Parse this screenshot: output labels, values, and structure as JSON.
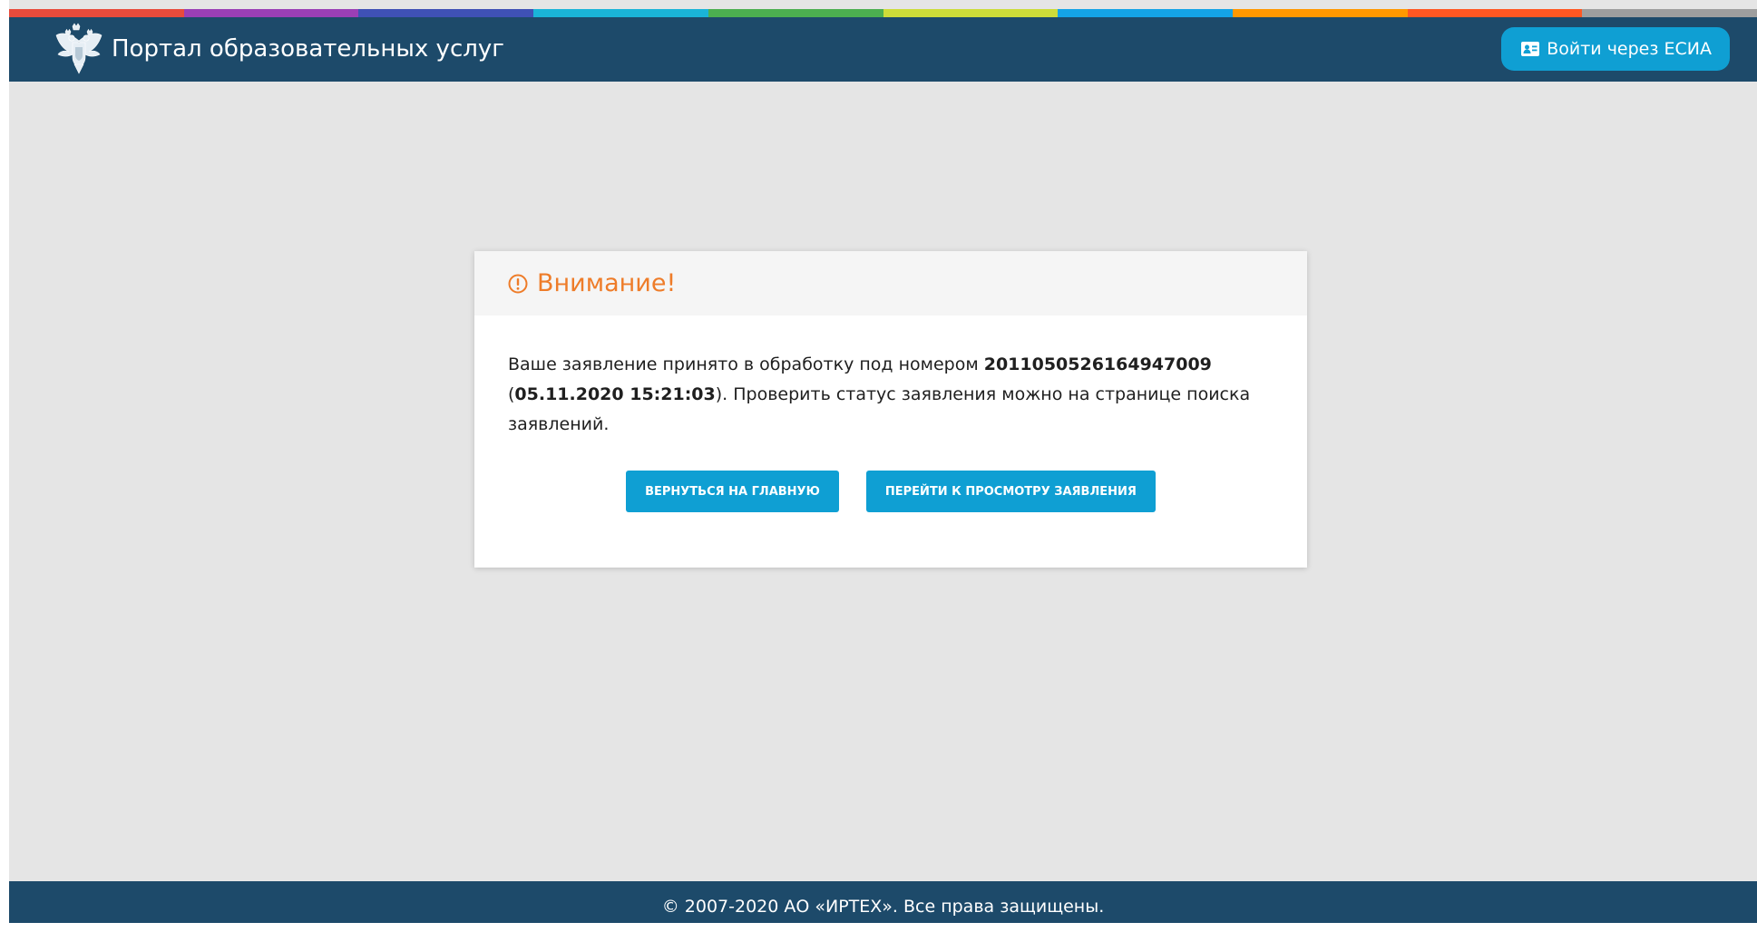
{
  "header": {
    "title": "Портал образовательных услуг",
    "login_button": "Войти через ЕСИА",
    "stripe_colors": [
      "#e84b3c",
      "#9b3fb5",
      "#3f51b5",
      "#1ab4d8",
      "#4caf50",
      "#cddc39",
      "#14a3e6",
      "#ff9800",
      "#ff5722",
      "#9e9e9e"
    ]
  },
  "dialog": {
    "title": "Внимание!",
    "message_part1": "Ваше заявление принято в обработку под номером ",
    "application_number": "2011050526164947009",
    "message_part2": "(",
    "application_datetime": "05.11.2020 15:21:03",
    "message_part3": "). Проверить статус заявления можно на странице поиска заявлений.",
    "button_home": "ВЕРНУТЬСЯ НА ГЛАВНУЮ",
    "button_view": "ПЕРЕЙТИ К ПРОСМОТРУ ЗАЯВЛЕНИЯ"
  },
  "footer": {
    "copyright": "© 2007-2020 АО «ИРТЕХ». Все права защищены."
  },
  "icons": {
    "logo": "coat-of-arms-icon",
    "login": "id-card-icon",
    "warning": "exclamation-circle-icon"
  },
  "colors": {
    "header_bg": "#1d4a6a",
    "accent": "#0f9fd3",
    "warning": "#ee7c29",
    "page_bg": "#e5e5e5"
  }
}
